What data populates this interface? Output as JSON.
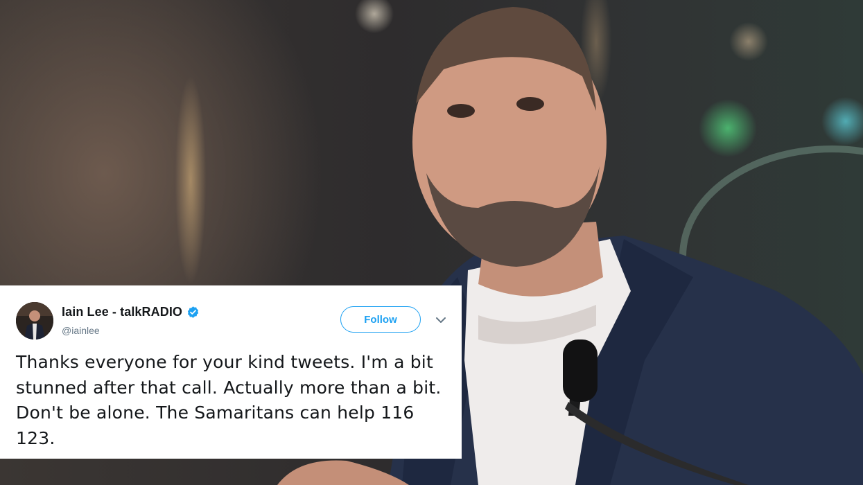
{
  "tweet": {
    "display_name": "Iain Lee - talkRADIO",
    "handle": "@iainlee",
    "follow_label": "Follow",
    "text": "Thanks everyone for your kind tweets. I'm a bit stunned after that call. Actually more than a bit. Don't be alone. The Samaritans can help 116 123.",
    "verified_icon": "verified-badge-icon",
    "menu_icon": "chevron-down-icon"
  },
  "colors": {
    "accent": "#1da1f2",
    "text": "#14171a",
    "muted": "#657786"
  }
}
